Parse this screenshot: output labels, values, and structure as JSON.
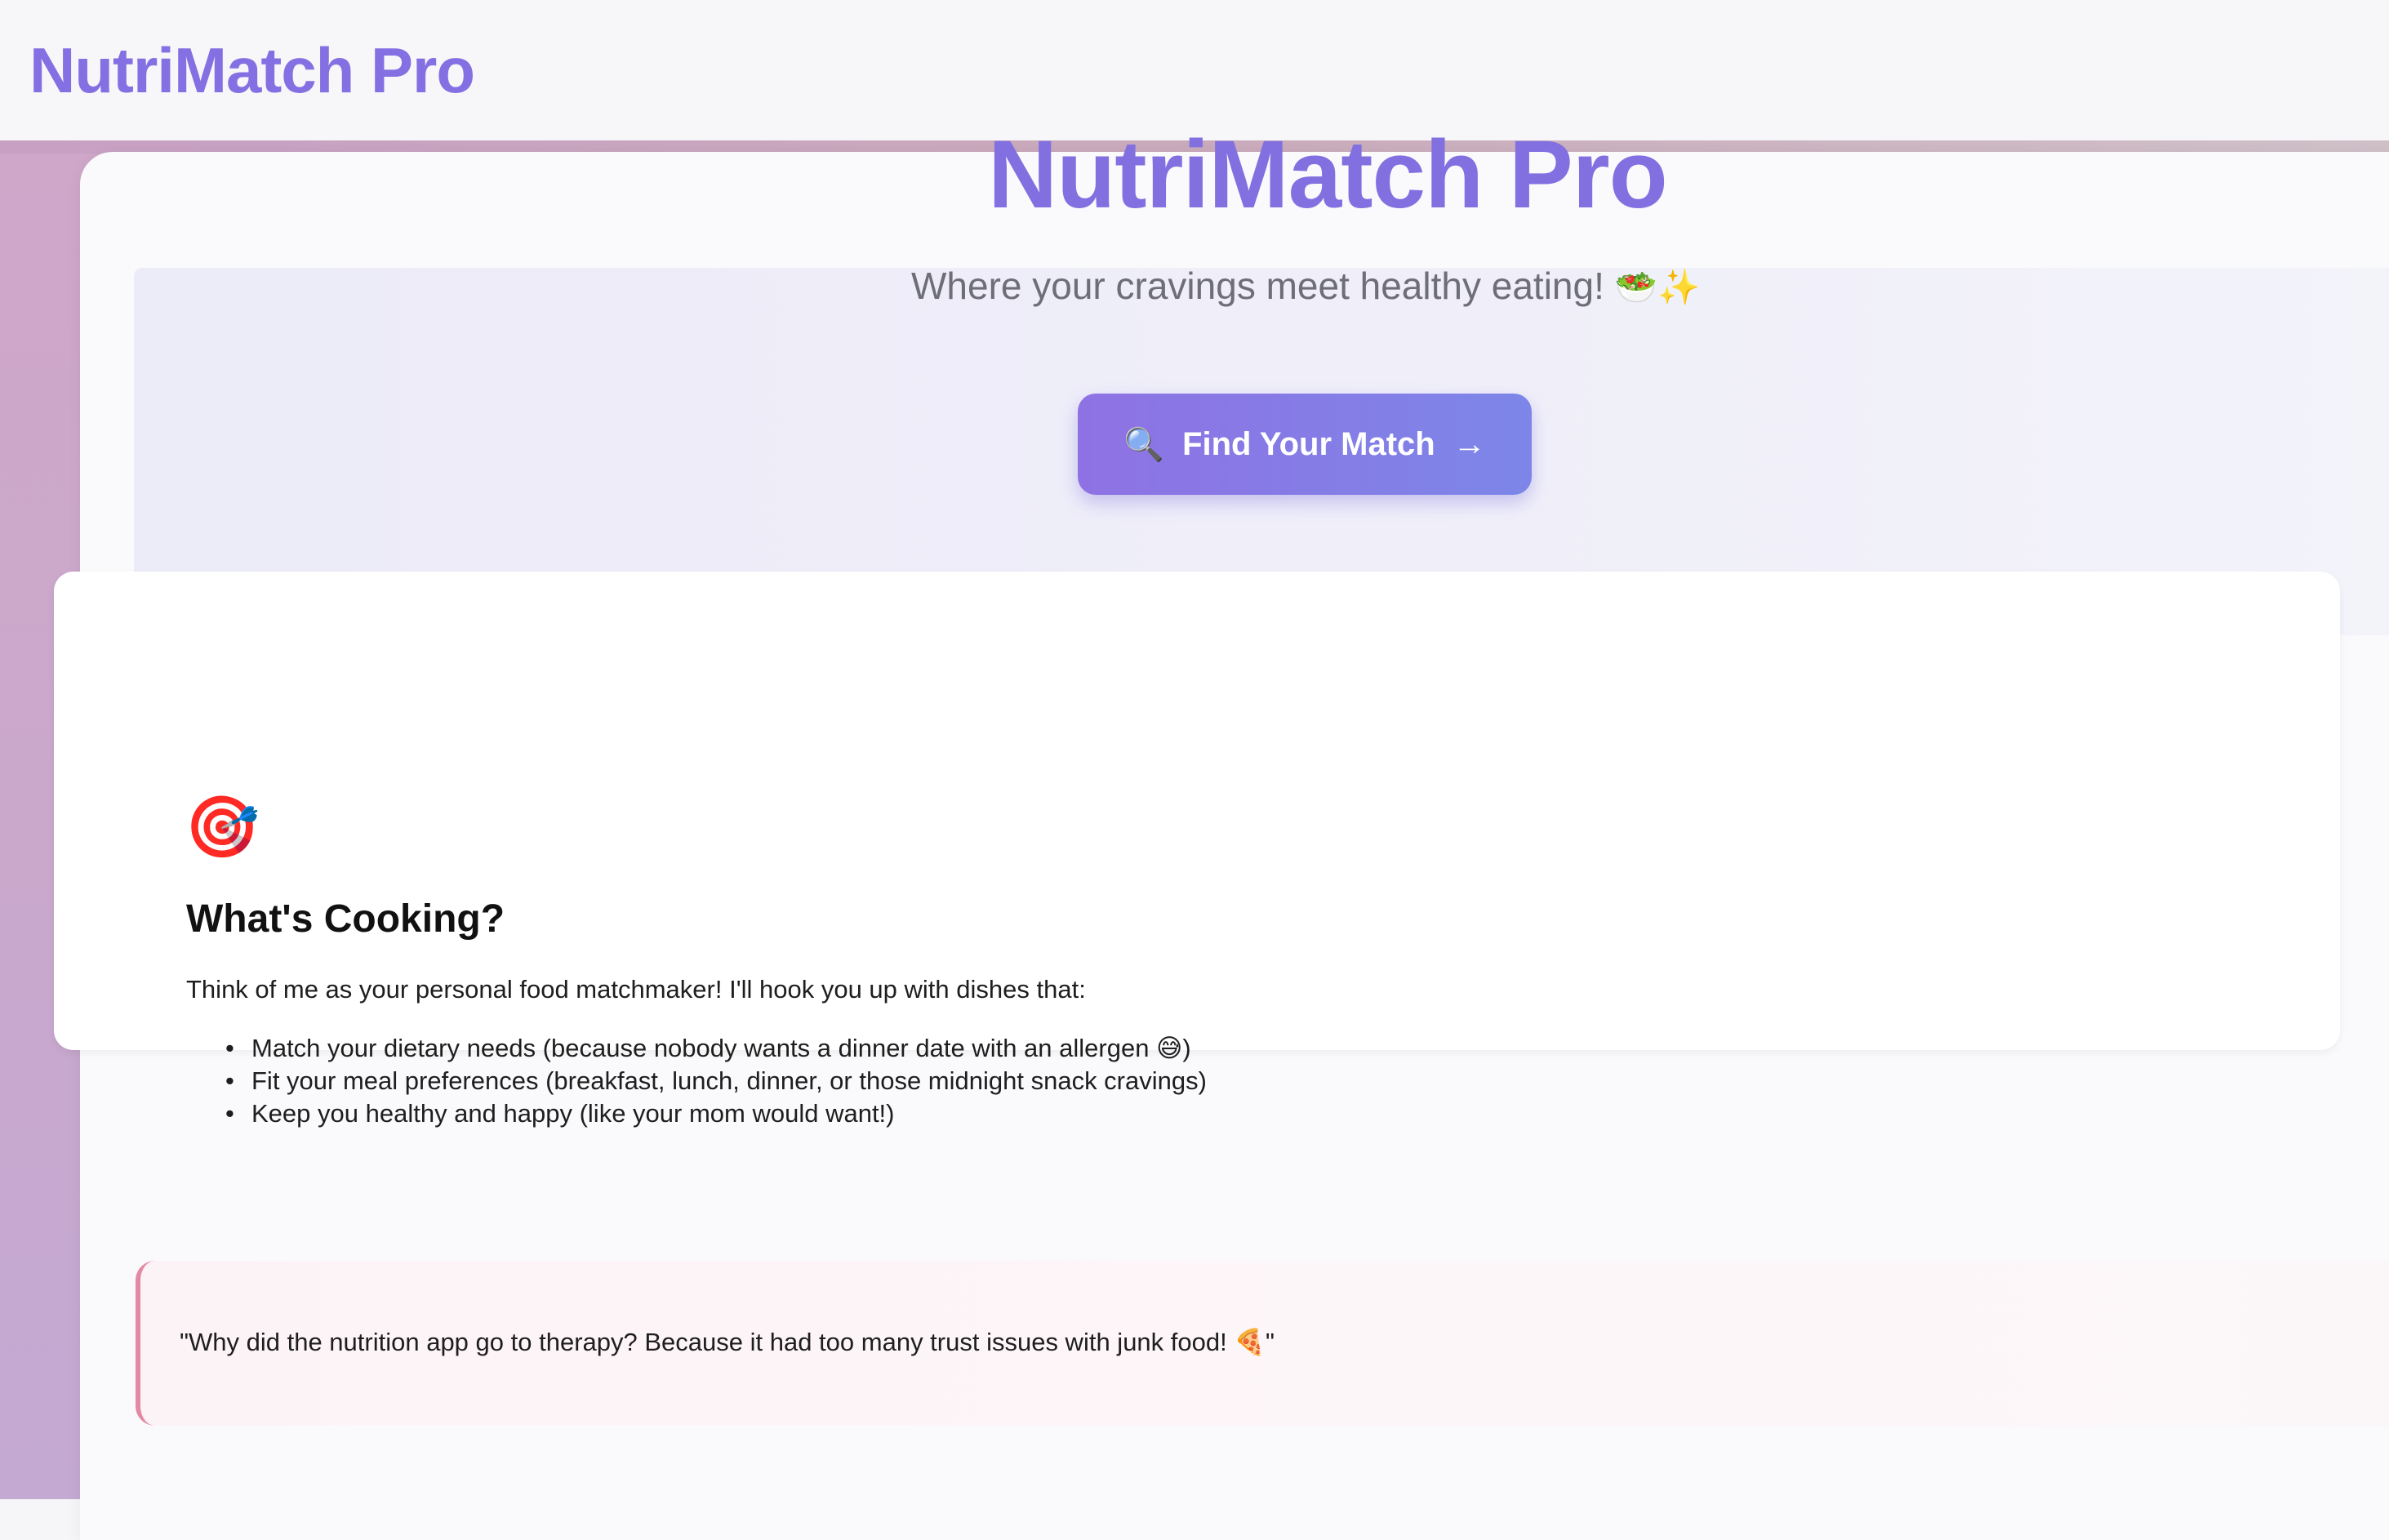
{
  "topbar": {
    "brand": "NutriMatch Pro"
  },
  "hero": {
    "title": "NutriMatch Pro",
    "subtitle": "Where your cravings meet healthy eating!",
    "subtitle_emoji": "🥗✨",
    "cta_icon": "🔍",
    "cta_label": "Find Your Match",
    "cta_arrow": "→"
  },
  "section": {
    "icon": "🎯",
    "title": "What's Cooking?",
    "intro": "Think of me as your personal food matchmaker! I'll hook you up with dishes that:",
    "bullets": [
      "Match your dietary needs (because nobody wants a dinner date with an allergen 😅)",
      "Fit your meal preferences (breakfast, lunch, dinner, or those midnight snack cravings)",
      "Keep you healthy and happy (like your mom would want!)"
    ]
  },
  "joke": {
    "text": "\"Why did the nutrition app go to therapy? Because it had too many trust issues with junk food! 🍕\""
  },
  "colors": {
    "brand": "#8470e2",
    "cta_start": "#8e72e4",
    "cta_end": "#7d86e8",
    "joke_accent": "#e489a4"
  }
}
